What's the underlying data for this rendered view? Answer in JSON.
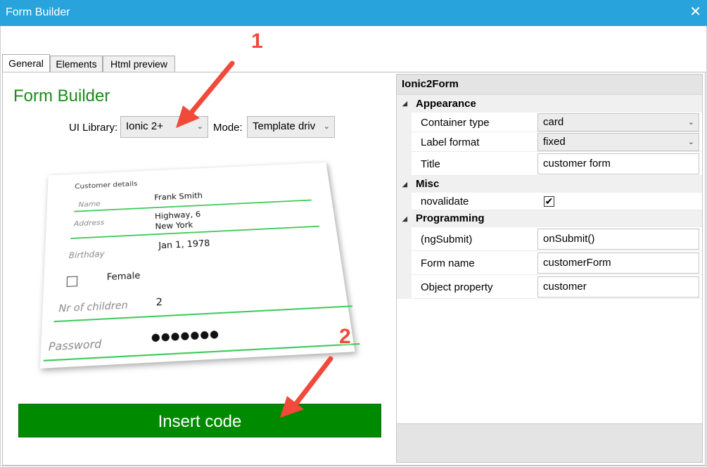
{
  "window": {
    "title": "Form Builder",
    "close_glyph": "✕"
  },
  "tabs": [
    {
      "label": "General",
      "active": true
    },
    {
      "label": "Elements",
      "active": false
    },
    {
      "label": "Html preview",
      "active": false
    }
  ],
  "general": {
    "heading": "Form Builder",
    "ui_library_label": "UI Library:",
    "ui_library_value": "Ionic 2+",
    "mode_label": "Mode:",
    "mode_value": "Template driv",
    "insert_button": "Insert code"
  },
  "preview": {
    "section_title": "Customer details",
    "name_label": "Name",
    "name_value": "Frank Smith",
    "address_label": "Address",
    "address_line1": "Highway, 6",
    "address_line2": "New York",
    "birthday_label": "Birthday",
    "birthday_value": "Jan 1, 1978",
    "female_label": "Female",
    "children_label": "Nr of children",
    "children_value": "2",
    "password_label": "Password",
    "password_value": "●●●●●●●"
  },
  "property_grid": {
    "object_name": "Ionic2Form",
    "categories": {
      "appearance": "Appearance",
      "misc": "Misc",
      "programming": "Programming"
    },
    "properties": {
      "container_type": {
        "name": "Container type",
        "value": "card"
      },
      "label_format": {
        "name": "Label format",
        "value": "fixed"
      },
      "title": {
        "name": "Title",
        "value": "customer form"
      },
      "novalidate": {
        "name": "novalidate",
        "checked": true,
        "glyph": "✔"
      },
      "ngsubmit": {
        "name": "(ngSubmit)",
        "value": "onSubmit()"
      },
      "form_name": {
        "name": "Form name",
        "value": "customerForm"
      },
      "object_property": {
        "name": "Object property",
        "value": "customer"
      }
    }
  },
  "annotations": {
    "marker1": "1",
    "marker2": "2"
  },
  "colors": {
    "titlebar": "#29a3db",
    "accent_green": "#1b8b1b",
    "button_green": "#008a00",
    "arrow_red": "#f04a3b"
  },
  "icons": {
    "dropdown": "chevron-down-icon",
    "collapse": "triangle-collapse-icon",
    "close": "close-icon"
  }
}
